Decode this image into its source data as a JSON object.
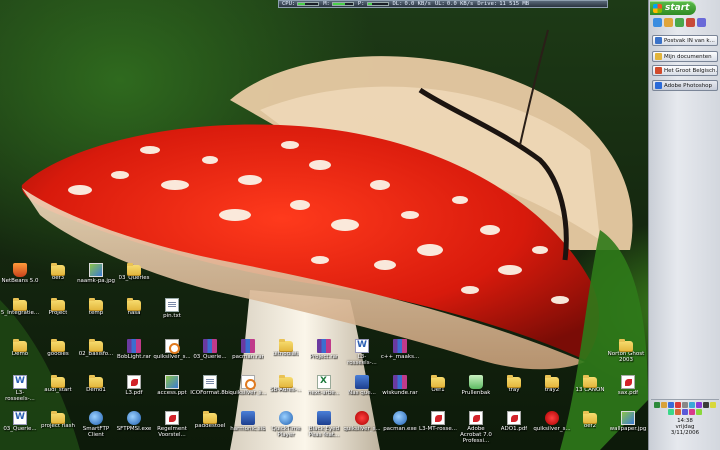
{
  "sysbar": {
    "cpu_label": "CPU:",
    "mem_label": "M:",
    "p_label": "P:",
    "dl_label": "DL:",
    "dl_value": "0.0 KB/s",
    "ul_label": "UL:",
    "ul_value": "0.0 KB/s",
    "drive_label": "Drive:",
    "drive_value": "11 515 MB"
  },
  "start": {
    "label": "start"
  },
  "taskbar": {
    "items": [
      {
        "label": "Postvak IN van k...",
        "icon": "mail-icon",
        "color": "#3a72c8"
      },
      {
        "label": "Mijn documenten",
        "icon": "folder-icon",
        "color": "#e2b43a"
      },
      {
        "label": "Het Groot Belgisch...",
        "icon": "browser-icon",
        "color": "#d14a2a"
      },
      {
        "label": "Adobe Photoshop",
        "icon": "photoshop-icon",
        "color": "#2a6ad8"
      }
    ]
  },
  "tray": {
    "time": "14:38",
    "day": "vrijdag",
    "date": "3/11/2006"
  },
  "desktop": {
    "row1": [
      {
        "label": "NetBeans 5.0",
        "icon": "netbeans-icon",
        "type": "shield"
      },
      {
        "label": "oef3",
        "icon": "folder-icon",
        "type": "folder"
      },
      {
        "label": "naamk-pa.jpg",
        "icon": "image-icon",
        "type": "img"
      },
      {
        "label": "03_Queries",
        "icon": "folder-icon",
        "type": "folder"
      }
    ],
    "row2": [
      {
        "label": "5_Integratie...",
        "icon": "folder-icon",
        "type": "folder"
      },
      {
        "label": "Project",
        "icon": "folder-icon",
        "type": "folder"
      },
      {
        "label": "temp",
        "icon": "folder-icon",
        "type": "folder"
      },
      {
        "label": "nasa",
        "icon": "folder-icon",
        "type": "folder"
      },
      {
        "label": "pin.txt",
        "icon": "text-file-icon",
        "type": "doc"
      }
    ],
    "row3": [
      {
        "label": "Demo",
        "icon": "folder-icon",
        "type": "folder"
      },
      {
        "label": "goodies",
        "icon": "folder-icon",
        "type": "folder"
      },
      {
        "label": "02_Basisfo...",
        "icon": "folder-icon",
        "type": "folder"
      },
      {
        "label": "BobLight.rar",
        "icon": "rar-icon",
        "type": "rar"
      },
      {
        "label": "quiksilver_s...",
        "icon": "java-icon",
        "type": "java"
      },
      {
        "label": "03_Querie...",
        "icon": "rar-icon",
        "type": "rar"
      },
      {
        "label": "pacman.rar",
        "icon": "rar-icon",
        "type": "rar"
      },
      {
        "label": "uitnodiais",
        "icon": "folder-icon",
        "type": "folder"
      },
      {
        "label": "Project.rar",
        "icon": "rar-icon",
        "type": "rar"
      },
      {
        "label": "L3-rosseels-...",
        "icon": "word-icon",
        "type": "word"
      },
      {
        "label": "c++_maaks...",
        "icon": "rar-icon",
        "type": "rar"
      },
      {
        "label": "Norton Ghost 2003",
        "icon": "folder-icon",
        "type": "folder"
      }
    ],
    "row4": [
      {
        "label": "L3-rosseels-...",
        "icon": "word-icon",
        "type": "word"
      },
      {
        "label": "audi_start",
        "icon": "folder-icon",
        "type": "folder"
      },
      {
        "label": "Demo1",
        "icon": "folder-icon",
        "type": "folder"
      },
      {
        "label": "L3.pdf",
        "icon": "pdf-icon",
        "type": "pdf"
      },
      {
        "label": "access.ppt",
        "icon": "ppt-icon",
        "type": "img"
      },
      {
        "label": "ICOFormat.8bi",
        "icon": "plugin-icon",
        "type": "doc"
      },
      {
        "label": "quiksilver_s...",
        "icon": "java-icon",
        "type": "java"
      },
      {
        "label": "SB-Adres-...",
        "icon": "folder-icon",
        "type": "folder"
      },
      {
        "label": "next-arbe...",
        "icon": "excel-icon",
        "type": "excel"
      },
      {
        "label": "Nas que...",
        "icon": "blue-icon",
        "type": "blue"
      },
      {
        "label": "wiskunde.rar",
        "icon": "rar-icon",
        "type": "rar"
      },
      {
        "label": "Oef1",
        "icon": "folder-icon",
        "type": "folder"
      },
      {
        "label": "Prullenbak",
        "icon": "recycle-bin-icon",
        "type": "recycle"
      },
      {
        "label": "tray",
        "icon": "folder-icon",
        "type": "folder"
      },
      {
        "label": "tray2",
        "icon": "folder-icon",
        "type": "folder"
      },
      {
        "label": "13 CANON",
        "icon": "folder-icon",
        "type": "folder"
      },
      {
        "label": "sax.pdf",
        "icon": "pdf-icon",
        "type": "pdf"
      }
    ],
    "row5": [
      {
        "label": "03_Querie...",
        "icon": "word-icon",
        "type": "word"
      },
      {
        "label": "project flash",
        "icon": "folder-icon",
        "type": "folder"
      },
      {
        "label": "SmartFTP Client",
        "icon": "ftp-icon",
        "type": "exe"
      },
      {
        "label": "SFTPMSI.exe",
        "icon": "installer-icon",
        "type": "exe"
      },
      {
        "label": "Regelment Voorstel...",
        "icon": "pdf-icon",
        "type": "pdf"
      },
      {
        "label": "paddestoel",
        "icon": "folder-icon",
        "type": "folder"
      },
      {
        "label": "harmonic.sib",
        "icon": "blue-icon",
        "type": "blue"
      },
      {
        "label": "QuickTime Player",
        "icon": "quicktime-icon",
        "type": "exe"
      },
      {
        "label": "Black Eyed Peas feat...",
        "icon": "blue-icon",
        "type": "blue"
      },
      {
        "label": "quiksilver_s...",
        "icon": "red-icon",
        "type": "red"
      },
      {
        "label": "pacman.exe",
        "icon": "exe-icon",
        "type": "exe"
      },
      {
        "label": "L3-MT-rosse...",
        "icon": "pdf-icon",
        "type": "pdf"
      },
      {
        "label": "Adobe Acrobat 7.0 Professi...",
        "icon": "acrobat-icon",
        "type": "pdf"
      },
      {
        "label": "ADO1.pdf",
        "icon": "pdf-icon",
        "type": "pdf"
      },
      {
        "label": "quiksilver_s...",
        "icon": "red-icon",
        "type": "red"
      },
      {
        "label": "oef2",
        "icon": "folder-icon",
        "type": "folder"
      },
      {
        "label": "wallpaper.jpg",
        "icon": "image-icon",
        "type": "img"
      }
    ]
  }
}
